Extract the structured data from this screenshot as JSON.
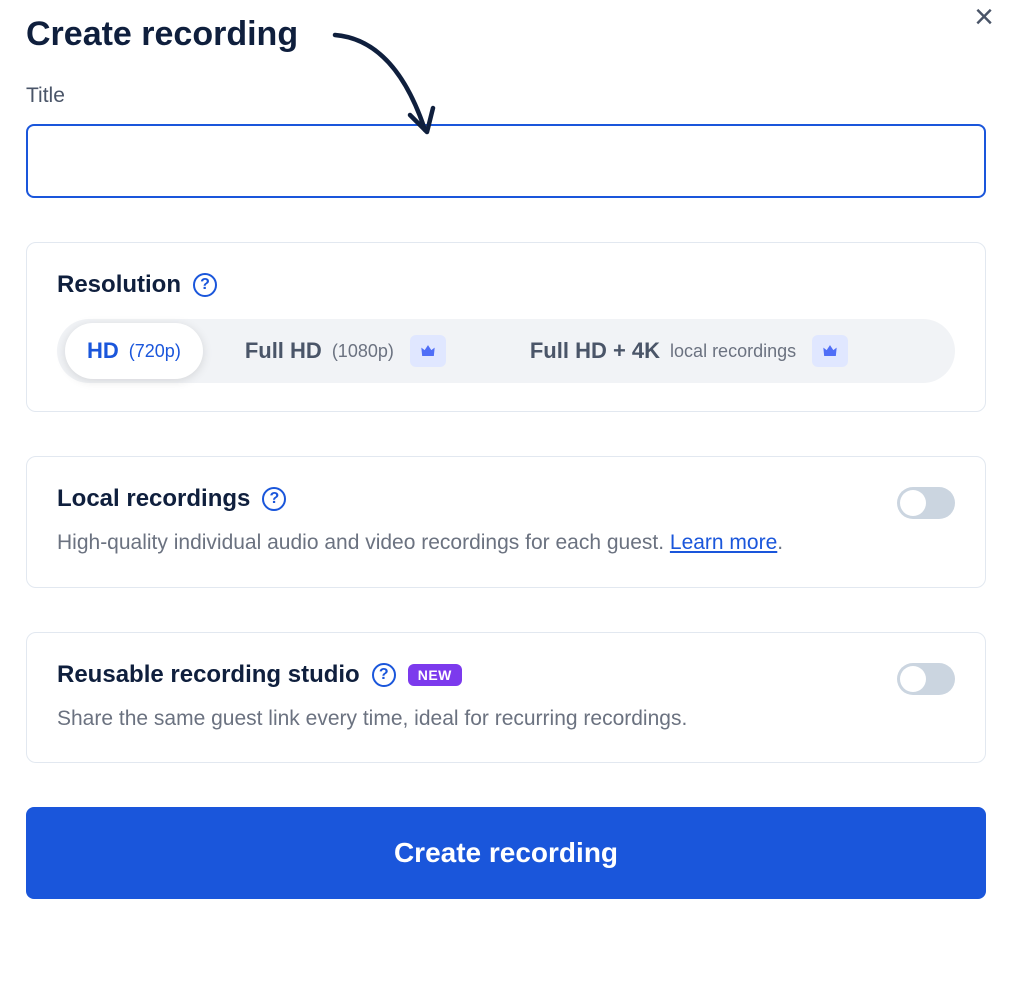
{
  "header": {
    "title": "Create recording"
  },
  "title_field": {
    "label": "Title",
    "value": ""
  },
  "resolution": {
    "title": "Resolution",
    "options": [
      {
        "main": "HD",
        "sub": "(720p)",
        "active": true,
        "premium": false
      },
      {
        "main": "Full HD",
        "sub": "(1080p)",
        "active": false,
        "premium": true
      },
      {
        "main": "Full HD + 4K",
        "sub": "local recordings",
        "active": false,
        "premium": true
      }
    ]
  },
  "local_recordings": {
    "title": "Local recordings",
    "description_prefix": "High-quality individual audio and video recordings for each guest. ",
    "learn_more": "Learn more",
    "enabled": false
  },
  "reusable_studio": {
    "title": "Reusable recording studio",
    "badge": "NEW",
    "description": "Share the same guest link every time, ideal for recurring recordings.",
    "enabled": false
  },
  "submit": {
    "label": "Create recording"
  }
}
